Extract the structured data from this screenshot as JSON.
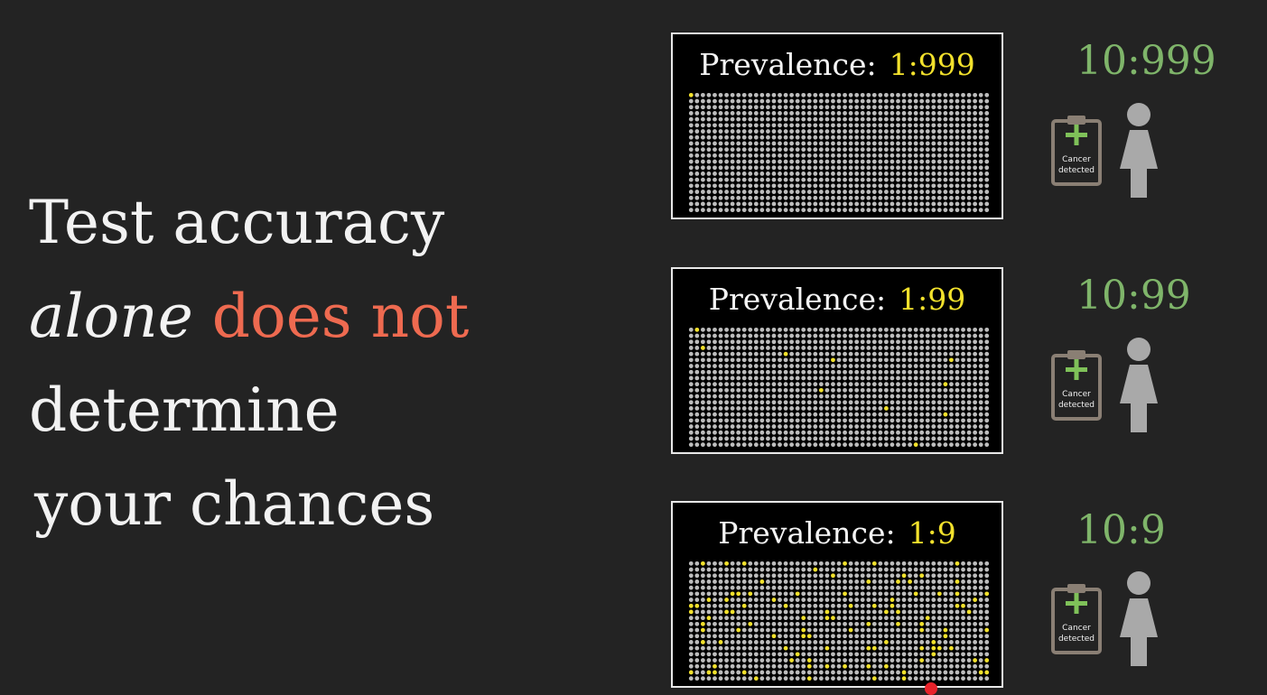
{
  "headline": {
    "line1": "Test accuracy",
    "line2_italic": "alone",
    "line2_red": "does not",
    "line3": "determine",
    "line4": "your chances"
  },
  "panels": [
    {
      "label": "Prevalence:",
      "value": "1:999",
      "ratio": "10:999",
      "badge_line1": "Cancer",
      "badge_line2": "detected",
      "positive_fraction": 0.001
    },
    {
      "label": "Prevalence:",
      "value": "1:99",
      "ratio": "10:99",
      "badge_line1": "Cancer",
      "badge_line2": "detected",
      "positive_fraction": 0.01
    },
    {
      "label": "Prevalence:",
      "value": "1:9",
      "ratio": "10:9",
      "badge_line1": "Cancer",
      "badge_line2": "detected",
      "positive_fraction": 0.1
    }
  ],
  "colors": {
    "background": "#232323",
    "negative_dot": "#bdbdbd",
    "positive_dot": "#f2e12c",
    "ratio_text": "#7fb56a",
    "highlight_text": "#ee6a50",
    "person": "#a9a9a9",
    "clipboard": "#8a7f74",
    "plus_sign": "#7fc159"
  },
  "icons": [
    "clipboard-icon",
    "person-icon"
  ]
}
